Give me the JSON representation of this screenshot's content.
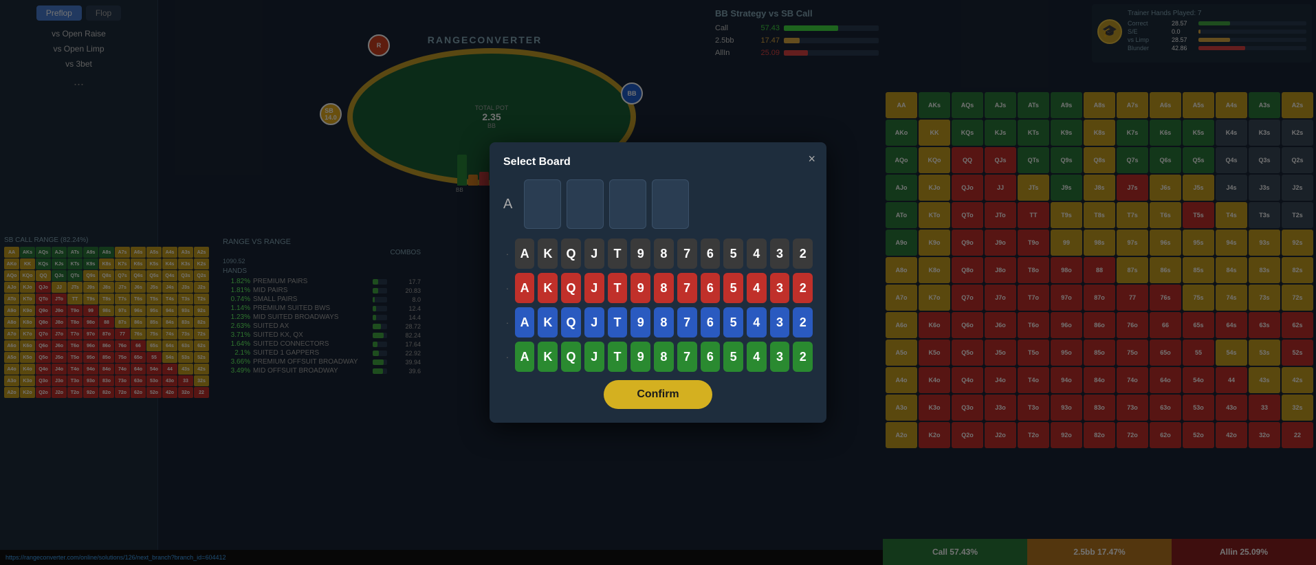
{
  "app": {
    "title": "RANGECONVERTER",
    "url": "https://rangeconverter.com/online/solutions/126/next_branch?branch_id=604412"
  },
  "left_sidebar": {
    "tab_preflop": "Preflop",
    "tab_flop": "Flop",
    "link_vs_open_raise": "vs Open Raise",
    "link_vs_open_limp": "vs Open Limp",
    "link_vs_3bet": "vs 3bet",
    "link_more": "..."
  },
  "pot_info": {
    "label": "TOTAL POT",
    "value": "2.35",
    "sub": "BB"
  },
  "bb_strategy": {
    "title": "BB Strategy vs SB Call",
    "rows": [
      {
        "name": "Call",
        "pct": "57.43",
        "color": "call"
      },
      {
        "name": "2.5bb",
        "pct": "17.47",
        "color": "raise"
      },
      {
        "name": "AllIn",
        "pct": "25.09",
        "color": "allin"
      }
    ]
  },
  "trainer": {
    "hands_played_label": "Trainer Hands Played:",
    "hands_played_value": "7",
    "stats": [
      {
        "label": "Correct",
        "value": "28.57",
        "bar_type": "green"
      },
      {
        "label": "S/E",
        "value": "0.0",
        "bar_type": "yellow"
      },
      {
        "label": "vs Limp",
        "value": "28.57",
        "bar_type": "yellow"
      },
      {
        "label": "Blunder",
        "value": "42.86",
        "bar_type": "red"
      }
    ]
  },
  "range_section": {
    "title": "SB CALL RANGE (82.24%)"
  },
  "rvr": {
    "title": "RANGE VS RANGE",
    "combos_label": "COMBOS",
    "total": "1090.52",
    "hands_label": "HANDS",
    "rows": [
      {
        "label": "PREMIUM PAIRS",
        "pct": "1.82%",
        "value": "17.7",
        "bar_pct": 40
      },
      {
        "label": "MID PAIRS",
        "pct": "1.81%",
        "value": "20.83",
        "bar_pct": 38
      },
      {
        "label": "SMALL PAIRS",
        "pct": "0.74%",
        "value": "8.0",
        "bar_pct": 16
      },
      {
        "label": "PREMIUM SUITED BWS",
        "pct": "1.14%",
        "value": "12.4",
        "bar_pct": 24
      },
      {
        "label": "MID SUITED BROADWAYS",
        "pct": "1.23%",
        "value": "14.4",
        "bar_pct": 26
      },
      {
        "label": "SUITED AX",
        "pct": "2.63%",
        "value": "28.72",
        "bar_pct": 55
      },
      {
        "label": "SUITED KX, QX",
        "pct": "3.71%",
        "value": "82.24",
        "bar_pct": 78
      },
      {
        "label": "SUITED CONNECTORS",
        "pct": "1.64%",
        "value": "17.64",
        "bar_pct": 35
      },
      {
        "label": "SUITED 1 GAPPERS",
        "pct": "2.1%",
        "value": "22.92",
        "bar_pct": 44
      },
      {
        "label": "PREMIUM OFFSUIT BROADWAY",
        "pct": "3.66%",
        "value": "39.94",
        "bar_pct": 77
      },
      {
        "label": "MID OFFSUIT BROADWAY",
        "pct": "3.49%",
        "value": "39.6",
        "bar_pct": 73
      }
    ]
  },
  "modal": {
    "title": "Select Board",
    "close_label": "×",
    "confirm_label": "Confirm",
    "rank_label": "A",
    "keyboard_rows": [
      {
        "dot": "·",
        "keys": [
          "A",
          "K",
          "Q",
          "J",
          "T",
          "9",
          "8",
          "7",
          "6",
          "5",
          "4",
          "3",
          "2"
        ],
        "style": "gray"
      },
      {
        "dot": "·",
        "keys": [
          "A",
          "K",
          "Q",
          "J",
          "T",
          "9",
          "8",
          "7",
          "6",
          "5",
          "4",
          "3",
          "2"
        ],
        "style": "red"
      },
      {
        "dot": "·",
        "keys": [
          "A",
          "K",
          "Q",
          "J",
          "T",
          "9",
          "8",
          "7",
          "6",
          "5",
          "4",
          "3",
          "2"
        ],
        "style": "blue"
      },
      {
        "dot": "·",
        "keys": [
          "A",
          "K",
          "Q",
          "J",
          "T",
          "9",
          "8",
          "7",
          "6",
          "5",
          "4",
          "3",
          "2"
        ],
        "style": "green"
      }
    ]
  },
  "main_range": {
    "headers": [
      "AQs",
      "AJs",
      "ATs",
      "A9s",
      "A8s",
      "A7s",
      "A6s",
      "A5s",
      "A4s",
      "A3s",
      "A2s",
      "KQs",
      "KJs",
      "KTs",
      "K9s",
      "K8s",
      "K7s",
      "K6s",
      "K5s",
      "K4s",
      "K3s",
      "K2s",
      "QQ",
      "QJs",
      "QTs",
      "Q9s",
      "Q8s",
      "Q7s",
      "Q6s",
      "Q5s",
      "Q4s",
      "Q3s",
      "Q2s"
    ],
    "cells": []
  },
  "bottom_actions": {
    "call": "Call 57.43%",
    "raise": "2.5bb 17.47%",
    "allin": "Allin 25.09%"
  }
}
